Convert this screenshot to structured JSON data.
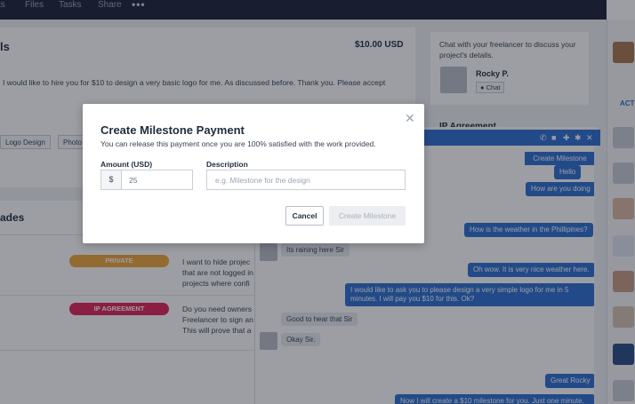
{
  "nav": {
    "items": [
      "ts",
      "Files",
      "Tasks",
      "Share"
    ],
    "more_icon": "more-dots-icon"
  },
  "project": {
    "title": "ls",
    "price": "$10.00 USD",
    "description": "I would like to hire you for $10 to design a very basic logo for me. As discussed before. Thank you. Please accept",
    "tags": [
      "Logo Design",
      "Photo"
    ]
  },
  "upgrades": {
    "title": "ades",
    "rows": [
      {
        "badge": "PRIVATE",
        "badge_color": "#f0a53a",
        "text_lines": [
          "I want to hide projec",
          "that are not logged in",
          "projects where confi"
        ]
      },
      {
        "badge": "IP AGREEMENT",
        "badge_color": "#e0235b",
        "text_lines": [
          "Do you need owners",
          "Freelancer to sign an",
          "This will prove that a"
        ]
      }
    ]
  },
  "sidebar": {
    "info_text": "Chat with your freelancer to discuss your project's details.",
    "freelancer_name": "Rocky P.",
    "chat_label": "Chat",
    "ip_title": "IP Agreement",
    "activity_label": "ACT"
  },
  "chat": {
    "create_milestone_label": "Create Milestone",
    "messages": [
      {
        "dir": "out",
        "text": "Hello"
      },
      {
        "dir": "out",
        "text": "How are you doing"
      },
      {
        "dir": "out",
        "text": "How is the weather in the Phillipines?"
      },
      {
        "dir": "in",
        "text": "Its raining here Sir"
      },
      {
        "dir": "out",
        "text": "Oh wow. It is very nice weather here."
      },
      {
        "dir": "out",
        "text": "I would like to ask you to please design a very simple logo for me in 5 minutes. I will pay you $10 for this. Ok?"
      },
      {
        "dir": "in",
        "text": "Good to hear that Sir"
      },
      {
        "dir": "in",
        "text": "Okay Sir."
      },
      {
        "dir": "out",
        "text": "Great Rocky"
      },
      {
        "dir": "out",
        "text": "Now I will create a $10 milestone for you. Just one minute."
      }
    ]
  },
  "modal": {
    "title": "Create Milestone Payment",
    "subtitle": "You can release this payment once you are 100% satisfied with the work provided.",
    "amount_label": "Amount (USD)",
    "currency_symbol": "$",
    "amount_value": "25",
    "description_label": "Description",
    "description_placeholder": "e.g. Milestone for the design",
    "cancel_label": "Cancel",
    "create_label": "Create Milestone"
  },
  "colors": {
    "accent": "#2f6fd1",
    "nav_bg": "#1d2437",
    "private_badge": "#f0a53a",
    "ip_badge": "#e0235b"
  }
}
